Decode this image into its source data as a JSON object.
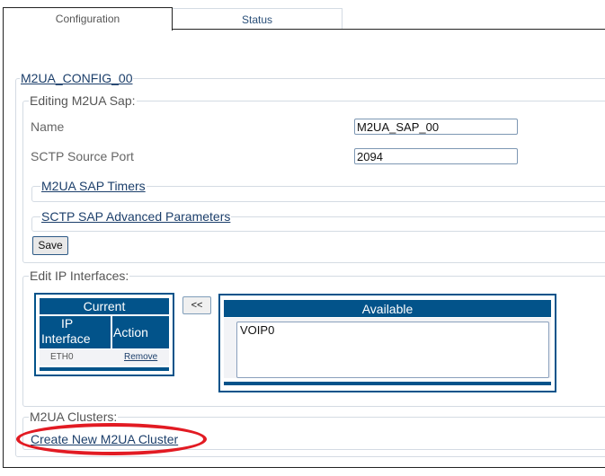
{
  "tabs": [
    {
      "label": "Configuration",
      "active": true
    },
    {
      "label": "Status",
      "active": false
    }
  ],
  "config": {
    "title": "M2UA_CONFIG_00",
    "sap_section": {
      "legend": "Editing M2UA Sap:",
      "fields": [
        {
          "label": "Name",
          "value": "M2UA_SAP_00"
        },
        {
          "label": "SCTP Source Port",
          "value": "2094"
        }
      ],
      "timers_link": "M2UA SAP Timers",
      "advanced_link": "SCTP SAP Advanced Parameters",
      "save_label": "Save"
    },
    "ip_section": {
      "legend": "Edit IP Interfaces:",
      "current": {
        "title": "Current",
        "columns": [
          "IP Interface",
          "Action"
        ],
        "rows": [
          {
            "interface": "ETH0",
            "action": "Remove"
          }
        ]
      },
      "move_label": "<<",
      "available": {
        "title": "Available",
        "options": [
          "VOIP0"
        ]
      }
    },
    "clusters_section": {
      "legend": "M2UA Clusters:",
      "create_link": "Create New M2UA Cluster"
    }
  },
  "colors": {
    "header_blue": "#02538a",
    "highlight_red": "#e21b23",
    "link": "#1c3f6b"
  }
}
